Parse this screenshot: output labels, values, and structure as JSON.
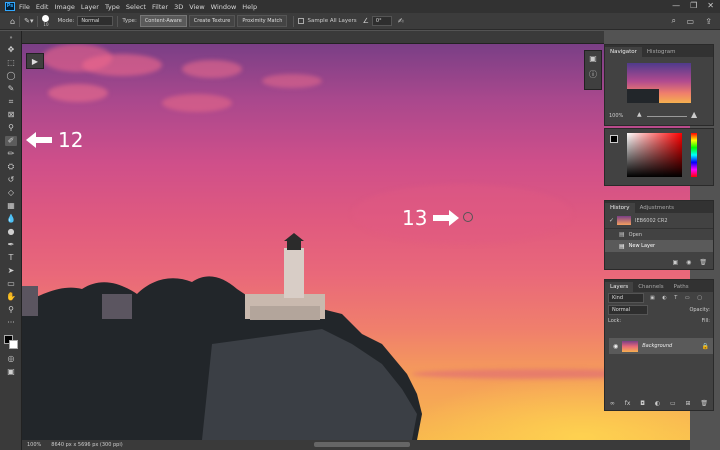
{
  "app": {
    "logo": "Ps",
    "accent": "#31a8ff"
  },
  "menu": [
    "File",
    "Edit",
    "Image",
    "Layer",
    "Type",
    "Select",
    "Filter",
    "3D",
    "View",
    "Window",
    "Help"
  ],
  "window_controls": [
    "—",
    "❐",
    "✕"
  ],
  "options": {
    "brush_size": "10",
    "mode_label": "Mode:",
    "mode_value": "Normal",
    "type_label": "Type:",
    "type_buttons": [
      "Content-Aware",
      "Create Texture",
      "Proximity Match"
    ],
    "sample_all": "Sample All Layers",
    "angle": "0°"
  },
  "annotations": {
    "left_number": "12",
    "center_number": "13"
  },
  "status": {
    "zoom": "100%",
    "doc_info": "8640 px x 5696 px (300 ppi)"
  },
  "navigator": {
    "tabs": [
      "Navigator",
      "Histogram"
    ],
    "zoom": "100%"
  },
  "history": {
    "tabs": [
      "History",
      "Adjustments"
    ],
    "snapshot": "IEB6002 CR2",
    "items": [
      "Open",
      "New Layer"
    ]
  },
  "layers": {
    "tabs": [
      "Layers",
      "Channels",
      "Paths"
    ],
    "kind_placeholder": "Kind",
    "blend_mode": "Normal",
    "opacity_label": "Opacity:",
    "lock_label": "Lock:",
    "fill_label": "Fill:",
    "layer_name": "Background"
  },
  "colors": {
    "accent": "#31a8ff",
    "sky_top": "#7a3f86",
    "sky_bottom": "#f8b84e"
  }
}
